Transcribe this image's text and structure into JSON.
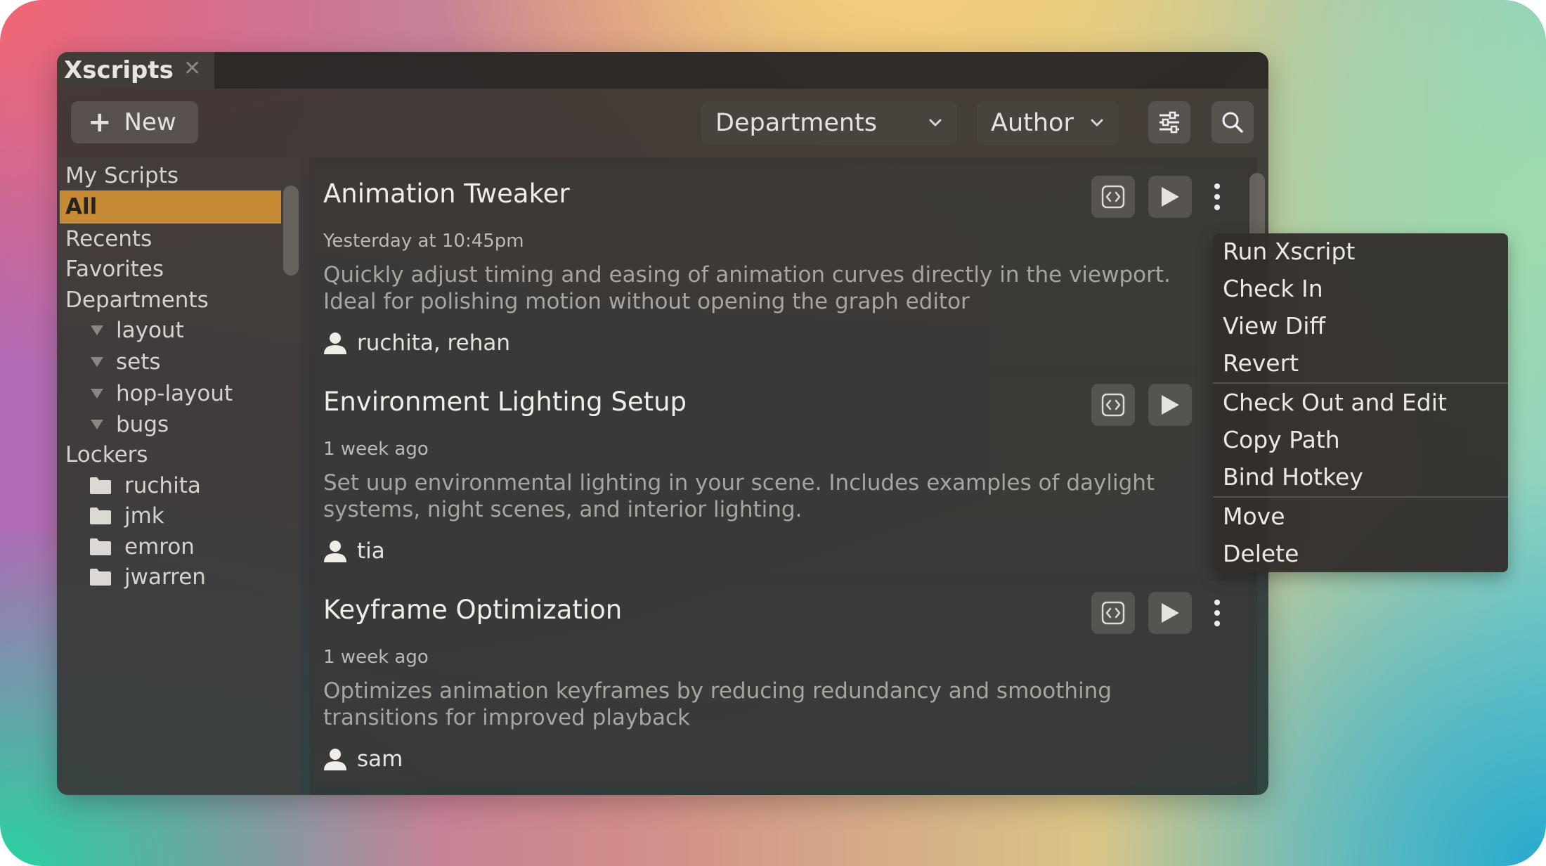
{
  "app": {
    "tab_title": "Xscripts",
    "tab_close_icon": "close-icon"
  },
  "toolbar": {
    "new_label": "New",
    "departments_label": "Departments",
    "author_label": "Author",
    "filter_icon": "sliders-icon",
    "search_icon": "search-icon"
  },
  "sidebar": {
    "my_scripts": "My Scripts",
    "all": "All",
    "recents": "Recents",
    "favorites": "Favorites",
    "departments": "Departments",
    "department_items": [
      "layout",
      "sets",
      "hop-layout",
      "bugs"
    ],
    "lockers": "Lockers",
    "locker_items": [
      "ruchita",
      "jmk",
      "emron",
      "jwarren"
    ]
  },
  "scripts": [
    {
      "title": "Animation Tweaker",
      "time": "Yesterday at 10:45pm",
      "description": "Quickly adjust timing and easing of animation curves directly in the viewport. Ideal for polishing motion without opening the graph editor",
      "authors": "ruchita, rehan"
    },
    {
      "title": "Environment Lighting Setup",
      "time": "1 week ago",
      "description": "Set uup environmental lighting in your scene. Includes examples of daylight systems, night scenes, and interior lighting.",
      "authors": "tia"
    },
    {
      "title": "Keyframe Optimization",
      "time": "1 week ago",
      "description": "Optimizes animation keyframes by reducing redundancy and smoothing transitions for improved playback",
      "authors": "sam"
    }
  ],
  "context_menu": {
    "items": [
      "Run Xscript",
      "Check In",
      "View Diff",
      "Revert",
      "Check Out and Edit",
      "Copy Path",
      "Bind Hotkey",
      "Move",
      "Delete"
    ]
  },
  "colors": {
    "selection": "#c78b35",
    "window_bg": "#3a3430"
  }
}
